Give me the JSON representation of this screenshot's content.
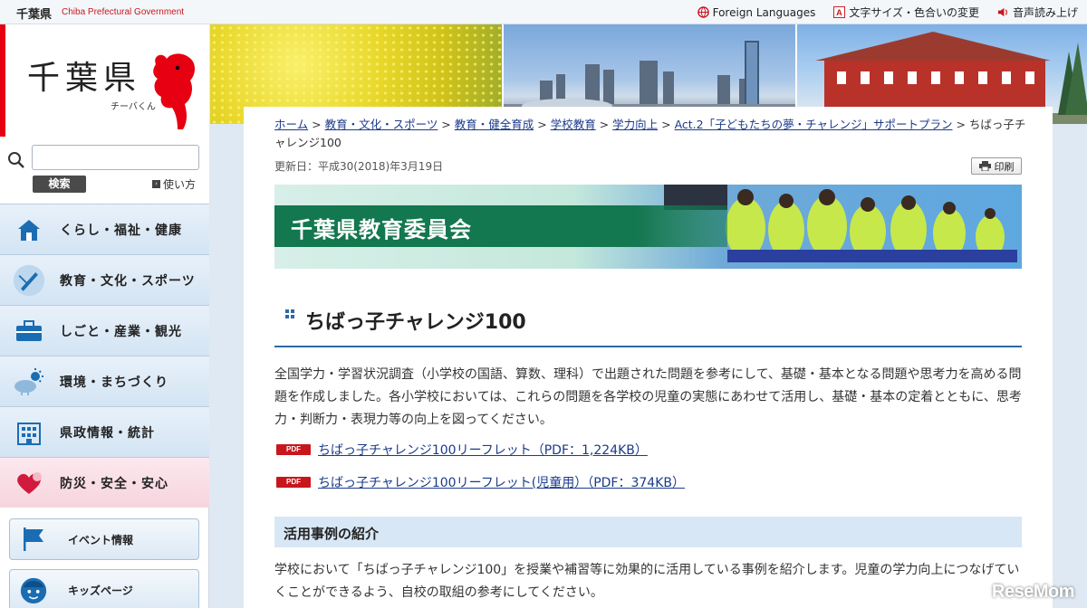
{
  "topbar": {
    "logo_jp": "千葉県",
    "logo_en": "Chiba Prefectural Government",
    "links": [
      {
        "label": "Foreign Languages",
        "icon": "globe-icon"
      },
      {
        "label": "文字サイズ・色合いの変更",
        "icon": "font-size-icon"
      },
      {
        "label": "音声読み上げ",
        "icon": "speaker-icon"
      }
    ]
  },
  "sidebar": {
    "logo_kanji": "千葉県",
    "mascot_name": "チーバくん",
    "search": {
      "placeholder": "",
      "button_label": "検索",
      "howto_label": "使い方"
    },
    "nav": [
      {
        "label": "くらし・福祉・健康",
        "icon": "house-icon"
      },
      {
        "label": "教育・文化・スポーツ",
        "icon": "pen-icon"
      },
      {
        "label": "しごと・産業・観光",
        "icon": "briefcase-icon"
      },
      {
        "label": "環境・まちづくり",
        "icon": "weather-icon"
      },
      {
        "label": "県政情報・統計",
        "icon": "building-icon"
      },
      {
        "label": "防災・安全・安心",
        "icon": "heart-icon"
      }
    ],
    "subnav": [
      {
        "label": "イベント情報",
        "icon": "flag-icon"
      },
      {
        "label": "キッズページ",
        "icon": "kid-icon"
      }
    ]
  },
  "main": {
    "breadcrumb": [
      "ホーム",
      "教育・文化・スポーツ",
      "教育・健全育成",
      "学校教育",
      "学力向上",
      "Act.2「子どもたちの夢・チャレンジ」サポートプラン"
    ],
    "breadcrumb_current": "ちばっ子チャレンジ100",
    "updated": "更新日：平成30(2018)年3月19日",
    "print_label": "印刷",
    "banner_title": "千葉県教育委員会",
    "page_title": "ちばっ子チャレンジ100",
    "intro": "全国学力・学習状況調査（小学校の国語、算数、理科）で出題された問題を参考にして、基礎・基本となる問題や思考力を高める問題を作成しました。各小学校においては、これらの問題を各学校の児童の実態にあわせて活用し、基礎・基本の定着とともに、思考力・判断力・表現力等の向上を図ってください。",
    "pdf_badge": "PDF",
    "pdf_links": [
      "ちばっ子チャレンジ100リーフレット（PDF：1,224KB）",
      "ちばっ子チャレンジ100リーフレット(児童用）（PDF：374KB）"
    ],
    "section_heading": "活用事例の紹介",
    "section_text": "学校において「ちばっ子チャレンジ100」を授業や補習等に効果的に活用している事例を紹介します。児童の学力向上につなげていくことができるよう、自校の取組の参考にしてください。"
  },
  "watermark": "ReseMom",
  "colors": {
    "brand_red": "#e60012",
    "link_blue": "#1a3a8a",
    "banner_green": "#13774f",
    "rule_blue": "#2c6aa8"
  }
}
